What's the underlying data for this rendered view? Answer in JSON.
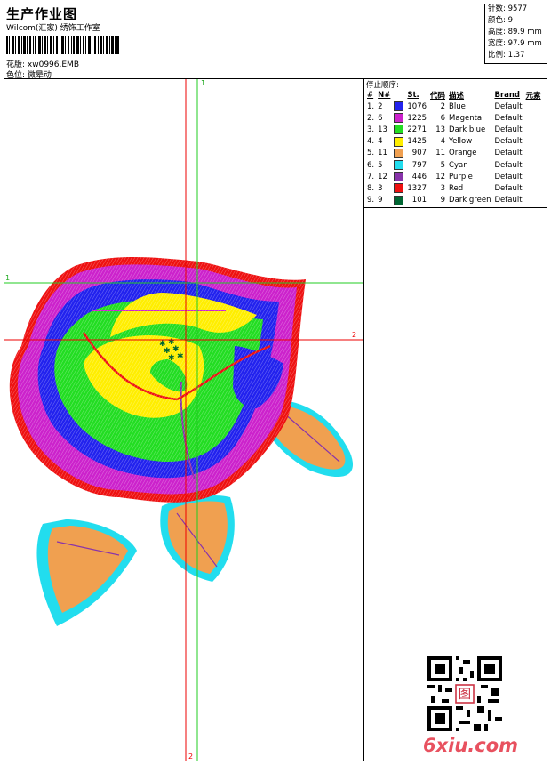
{
  "header": {
    "title": "生产作业图",
    "company": "Wilcom(汇家) 绣饰工作室",
    "file_label": "花版:",
    "file_name": "xw0996.EMB",
    "position_label": "色位:",
    "position_value": "微晕动"
  },
  "stats": {
    "stitches": "针数: 9577",
    "colors": "颜色: 9",
    "height": "高度: 89.9 mm",
    "width": "宽度: 97.9 mm",
    "scale": "比例: 1.37"
  },
  "color_panel": {
    "title": "停止顺序:",
    "columns": [
      "#",
      "N#",
      "St.",
      "代码",
      "描述",
      "Brand",
      "元素"
    ],
    "rows": [
      {
        "idx": "1.",
        "n": "2",
        "st": "1076",
        "code": "2",
        "desc": "Blue",
        "brand": "Default",
        "color": "#2222ee"
      },
      {
        "idx": "2.",
        "n": "6",
        "st": "1225",
        "code": "6",
        "desc": "Magenta",
        "brand": "Default",
        "color": "#cc22cc"
      },
      {
        "idx": "3.",
        "n": "13",
        "st": "2271",
        "code": "13",
        "desc": "Dark blue",
        "brand": "Default",
        "color": "#22dd22"
      },
      {
        "idx": "4.",
        "n": "4",
        "st": "1425",
        "code": "4",
        "desc": "Yellow",
        "brand": "Default",
        "color": "#ffee00"
      },
      {
        "idx": "5.",
        "n": "11",
        "st": "907",
        "code": "11",
        "desc": "Orange",
        "brand": "Default",
        "color": "#f0a050"
      },
      {
        "idx": "6.",
        "n": "5",
        "st": "797",
        "code": "5",
        "desc": "Cyan",
        "brand": "Default",
        "color": "#22ddee"
      },
      {
        "idx": "7.",
        "n": "12",
        "st": "446",
        "code": "12",
        "desc": "Purple",
        "brand": "Default",
        "color": "#8833aa"
      },
      {
        "idx": "8.",
        "n": "3",
        "st": "1327",
        "code": "3",
        "desc": "Red",
        "brand": "Default",
        "color": "#ee1111"
      },
      {
        "idx": "9.",
        "n": "9",
        "st": "101",
        "code": "9",
        "desc": "Dark green",
        "brand": "Default",
        "color": "#006633"
      }
    ]
  },
  "canvas": {
    "axis_labels": {
      "top": "1",
      "left": "1",
      "right": "2",
      "bottom": "2"
    },
    "colors": {
      "red_line": "#ee0000",
      "green_line": "#22cc22"
    }
  },
  "watermark": "6xiu.com",
  "qr_stamp": "图"
}
